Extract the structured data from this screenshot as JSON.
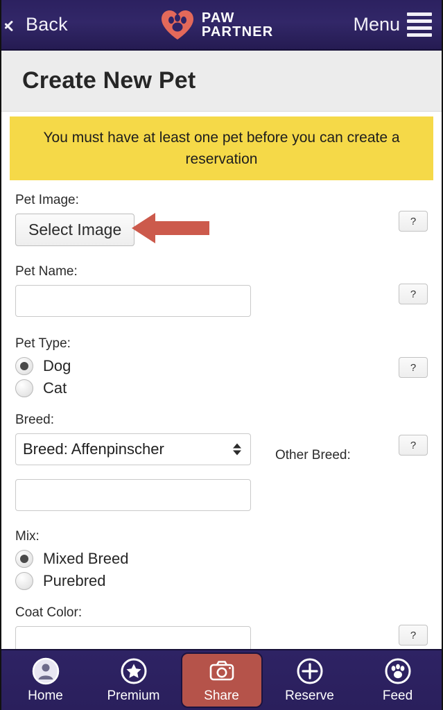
{
  "header": {
    "back_label": "Back",
    "back_icon": "chevron-left-icon",
    "brand_line1": "PAW",
    "brand_line2": "PARTNER",
    "brand_icon": "heart-paw-logo-icon",
    "menu_label": "Menu",
    "menu_icon": "hamburger-icon",
    "bar_color": "#2f2466"
  },
  "page": {
    "title": "Create New Pet"
  },
  "warning": {
    "text": "You must have at least one pet before you can create a reservation",
    "background_color": "#f5d948"
  },
  "annotation": {
    "arrow_icon": "left-arrow-annotation-icon",
    "arrow_color": "#cc5a4c"
  },
  "form": {
    "help_label": "?",
    "pet_image": {
      "label": "Pet Image:",
      "button_label": "Select Image"
    },
    "pet_name": {
      "label": "Pet Name:",
      "value": "",
      "placeholder": ""
    },
    "pet_type": {
      "label": "Pet Type:",
      "options": [
        {
          "label": "Dog",
          "selected": true
        },
        {
          "label": "Cat",
          "selected": false
        }
      ]
    },
    "breed": {
      "label": "Breed:",
      "selected": "Breed: Affenpinscher",
      "other_breed_label": "Other Breed:",
      "other_breed_value": "",
      "options": [
        "Breed: Affenpinscher"
      ]
    },
    "mix": {
      "label": "Mix:",
      "options": [
        {
          "label": "Mixed Breed",
          "selected": true
        },
        {
          "label": "Purebred",
          "selected": false
        }
      ]
    },
    "coat_color": {
      "label": "Coat Color:",
      "value": ""
    }
  },
  "bottom_nav": {
    "items": [
      {
        "label": "Home",
        "icon": "person-avatar-icon",
        "active": false
      },
      {
        "label": "Premium",
        "icon": "star-circle-icon",
        "active": false
      },
      {
        "label": "Share",
        "icon": "camera-icon",
        "active": true
      },
      {
        "label": "Reserve",
        "icon": "plus-circle-icon",
        "active": false
      },
      {
        "label": "Feed",
        "icon": "paw-circle-icon",
        "active": false
      }
    ],
    "active_color": "#b5534a",
    "bar_color": "#2a1f5c"
  }
}
